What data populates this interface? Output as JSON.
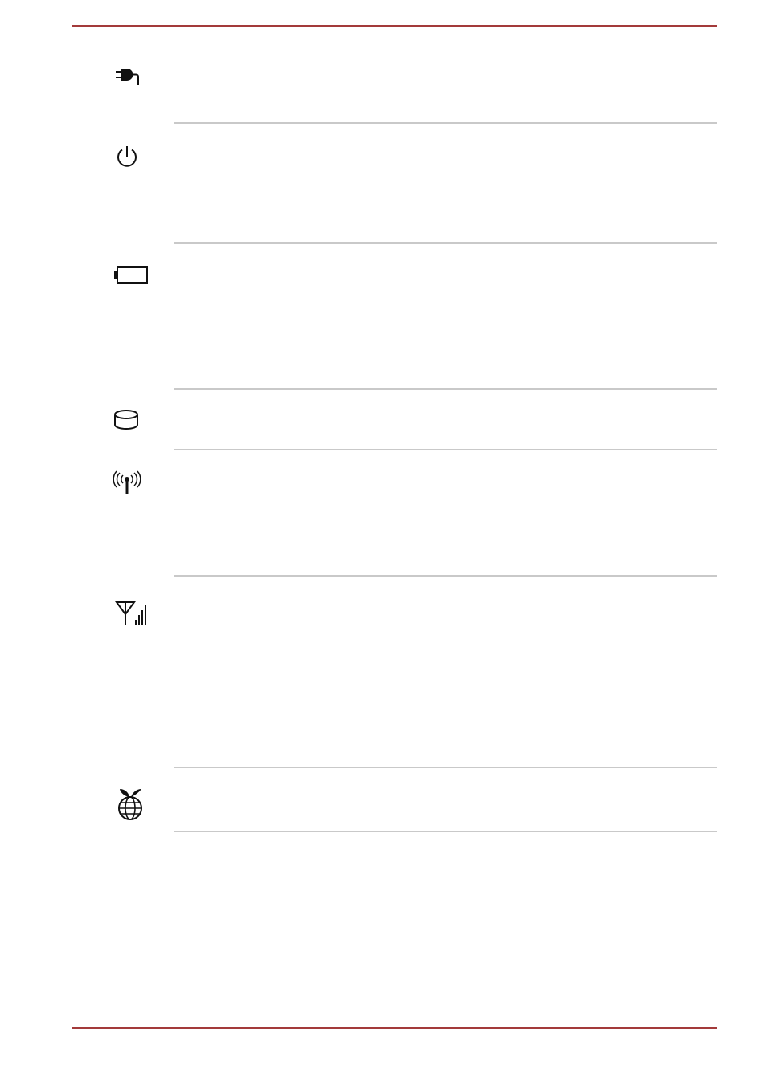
{
  "document": {
    "header_rule": "top-rule",
    "footer_rule": "bottom-rule",
    "accent_color": "#a33a3a",
    "separator_color": "#c9c9c9"
  },
  "indicators": [
    {
      "icon": "dc-in-plug-icon"
    },
    {
      "icon": "power-icon"
    },
    {
      "icon": "battery-icon"
    },
    {
      "icon": "storage-drive-icon"
    },
    {
      "icon": "wireless-antenna-icon"
    },
    {
      "icon": "mobile-signal-icon"
    },
    {
      "icon": "eco-globe-icon"
    }
  ]
}
